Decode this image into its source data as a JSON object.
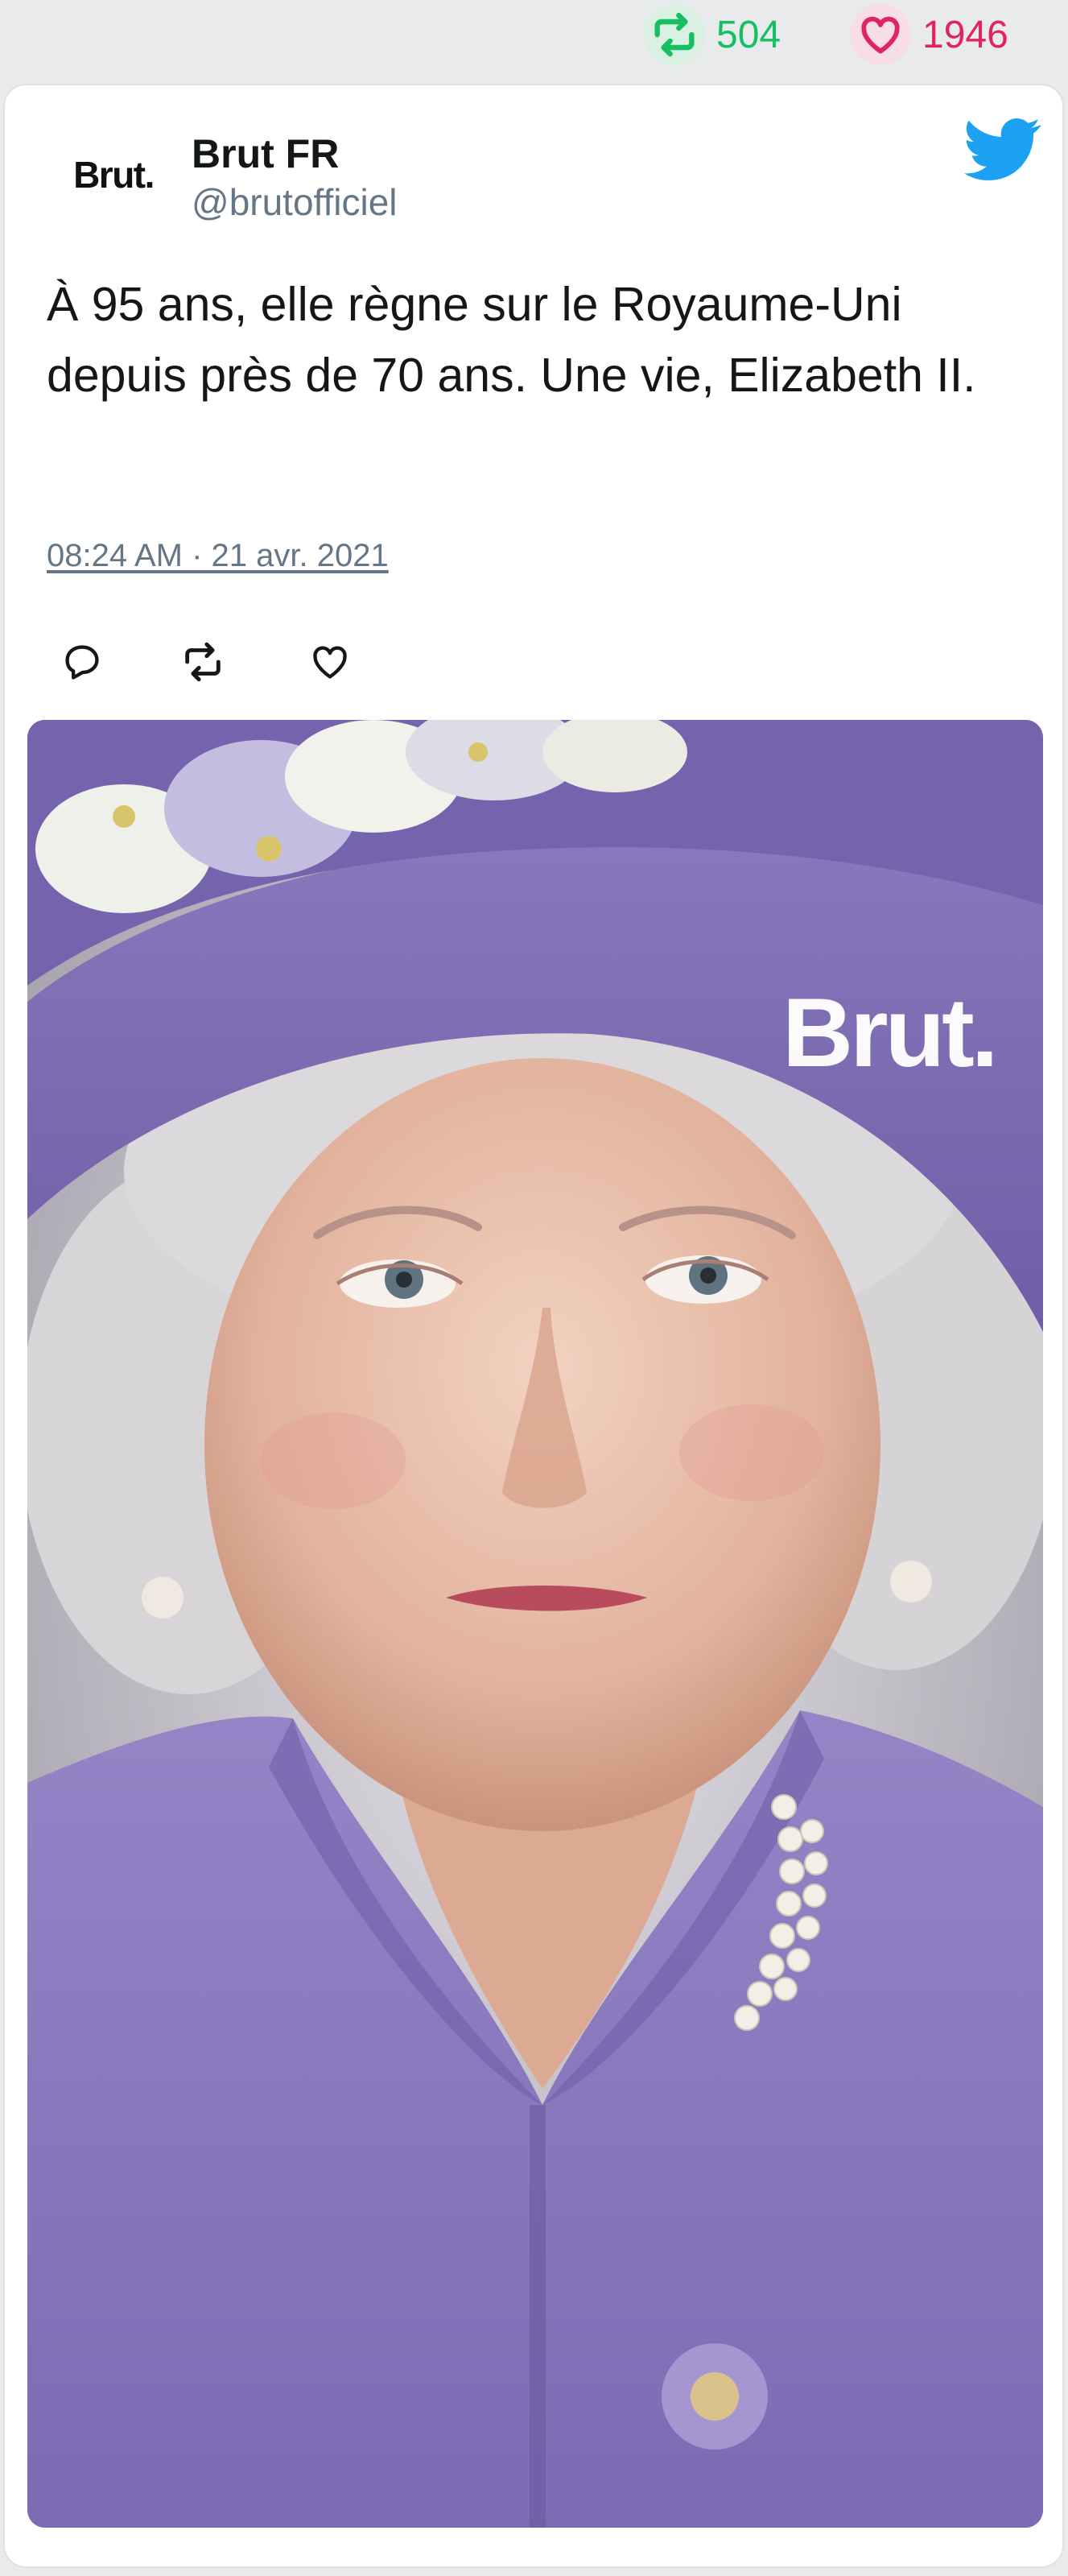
{
  "stats": {
    "retweets": "504",
    "retweet_icon": "retweet-icon",
    "likes": "1946",
    "like_icon": "heart-icon"
  },
  "tweet": {
    "avatar_text": "Brut.",
    "author_name": "Brut FR",
    "author_handle": "@brutofficiel",
    "brand_icon": "twitter-bird-icon",
    "text": "À 95 ans, elle règne sur le Royaume-Uni depuis près de 70 ans. Une vie, Elizabeth II.",
    "timestamp": "08:24 AM · 21 avr. 2021",
    "actions": [
      {
        "name": "reply",
        "icon": "reply-icon"
      },
      {
        "name": "retweet",
        "icon": "retweet-icon"
      },
      {
        "name": "like",
        "icon": "heart-icon"
      }
    ],
    "media": {
      "watermark": "Brut."
    }
  },
  "colors": {
    "page_background": "#e8eaec",
    "retweet_green": "#17bf63",
    "like_pink": "#e0245e",
    "twitter_blue": "#1da1f2",
    "secondary_text": "#657786",
    "hat_purple": "#7f6db2",
    "coat_purple": "#8d7cbf"
  }
}
